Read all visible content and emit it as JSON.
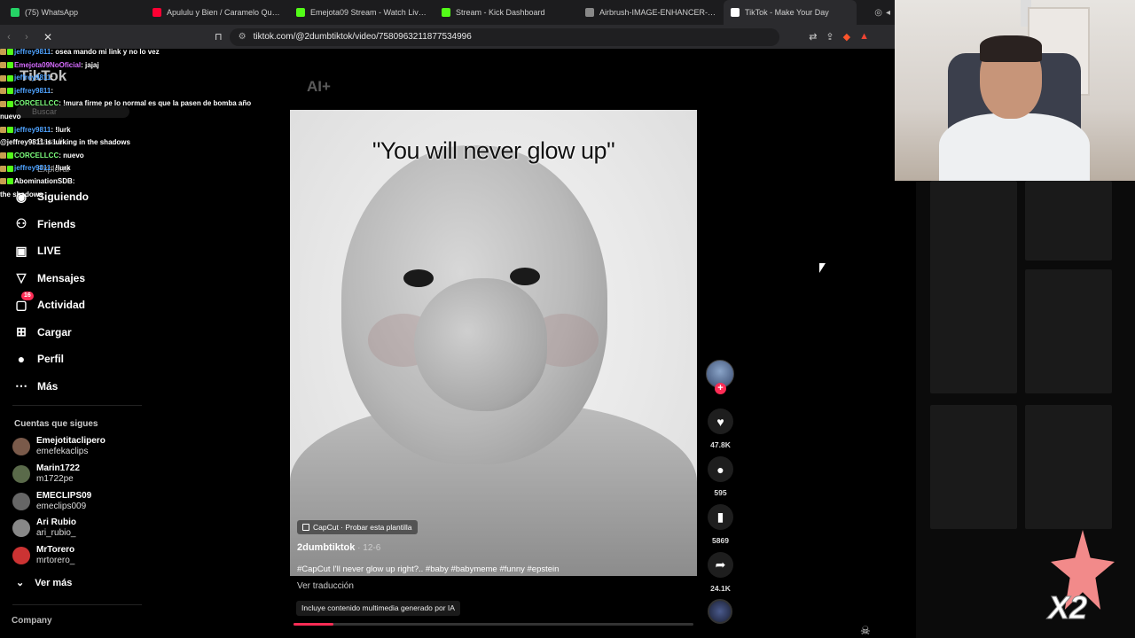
{
  "browser": {
    "tabs": [
      {
        "label": "(75) WhatsApp",
        "color": "#25d366"
      },
      {
        "label": "Apululu y Bien / Caramelo Que Le Fa",
        "color": "#ff0033"
      },
      {
        "label": "Emejota09 Stream - Watch Live on K",
        "color": "#53fc18"
      },
      {
        "label": "Stream - Kick Dashboard",
        "color": "#53fc18"
      },
      {
        "label": "Airbrush-IMAGE-ENHANCER-17648",
        "color": "#888888"
      },
      {
        "label": "TikTok - Make Your Day",
        "color": "#ffffff"
      }
    ],
    "url": "tiktok.com/@2dumbtiktok/video/7580963211877534996"
  },
  "chat": [
    {
      "user": "jeffrey9811",
      "text": ": osea mando mi link y no lo vez",
      "color": "#4fa3ff"
    },
    {
      "user": "Emejota09NoOficial",
      "text": ": jajaj",
      "color": "#d66bff"
    },
    {
      "user": "jeffrey9811",
      "text": ": ",
      "color": "#4fa3ff"
    },
    {
      "user": "jeffrey9811",
      "text": ": ",
      "color": "#4fa3ff"
    },
    {
      "user": "",
      "text": "",
      "color": "#ffffff"
    },
    {
      "user": "CORCELLCC",
      "text": ": !mura firme pe lo normal es que la pasen de bomba año",
      "color": "#7dff7d"
    },
    {
      "user": "",
      "text": "nuevo",
      "color": "#ffffff"
    },
    {
      "user": "jeffrey9811",
      "text": ": !lurk",
      "color": "#4fa3ff"
    },
    {
      "user": "",
      "text": "@jeffrey9811 is lurking in the shadows",
      "color": "#ffffff"
    },
    {
      "user": "CORCELLCC",
      "text": ": nuevo",
      "color": "#7dff7d"
    },
    {
      "user": "jeffrey9811",
      "text": ": !lurk",
      "color": "#4fa3ff"
    },
    {
      "user": "AbominationSDB",
      "text": ":",
      "color": "#ffffff"
    },
    {
      "user": "",
      "text": "the shadows",
      "color": "#ffffff"
    }
  ],
  "sidebar": {
    "logo": "TikTok",
    "search_placeholder": "Buscar",
    "faded_items": [
      "Para ti",
      "Explorar"
    ],
    "nav": [
      {
        "label": "Siguiendo",
        "icon": "following-icon"
      },
      {
        "label": "Friends",
        "icon": "friends-icon"
      },
      {
        "label": "LIVE",
        "icon": "live-icon"
      },
      {
        "label": "Mensajes",
        "icon": "messages-icon"
      },
      {
        "label": "Actividad",
        "icon": "activity-icon",
        "badge": "16"
      },
      {
        "label": "Cargar",
        "icon": "upload-icon"
      },
      {
        "label": "Perfil",
        "icon": "profile-icon"
      },
      {
        "label": "Más",
        "icon": "more-icon"
      }
    ],
    "following_title": "Cuentas que sigues",
    "accounts": [
      {
        "name": "Emejotitaclipero",
        "handle": "emefekaclips",
        "color": "#7a5a4a"
      },
      {
        "name": "Marin1722",
        "handle": "m1722pe",
        "color": "#5a6a4a"
      },
      {
        "name": "EMECLIPS09",
        "handle": "emeclips009",
        "color": "#666666"
      },
      {
        "name": "Ari Rubio",
        "handle": "ari_rubio_",
        "color": "#888888"
      },
      {
        "name": "MrTorero",
        "handle": "mrtorero_",
        "color": "#cc3333"
      }
    ],
    "see_more": "Ver más",
    "company": "Company"
  },
  "video": {
    "ai_label": "AI+",
    "caption_overlay": "\"You will never glow up\"",
    "capcut_tag": "CapCut · Probar esta plantilla",
    "author": "2dumbtiktok",
    "date": " · 12-6",
    "description": "#CapCut I'll never glow up right?.. #baby #babymeme #funny #epstein",
    "translate": "Ver traducción",
    "ai_disclaimer": "Incluye contenido multimedia generado por IA",
    "progress": 0.1
  },
  "actions": {
    "likes": "47.8K",
    "comments": "595",
    "saves": "5869",
    "shares": "24.1K"
  },
  "overlay": {
    "x2": "X2"
  }
}
